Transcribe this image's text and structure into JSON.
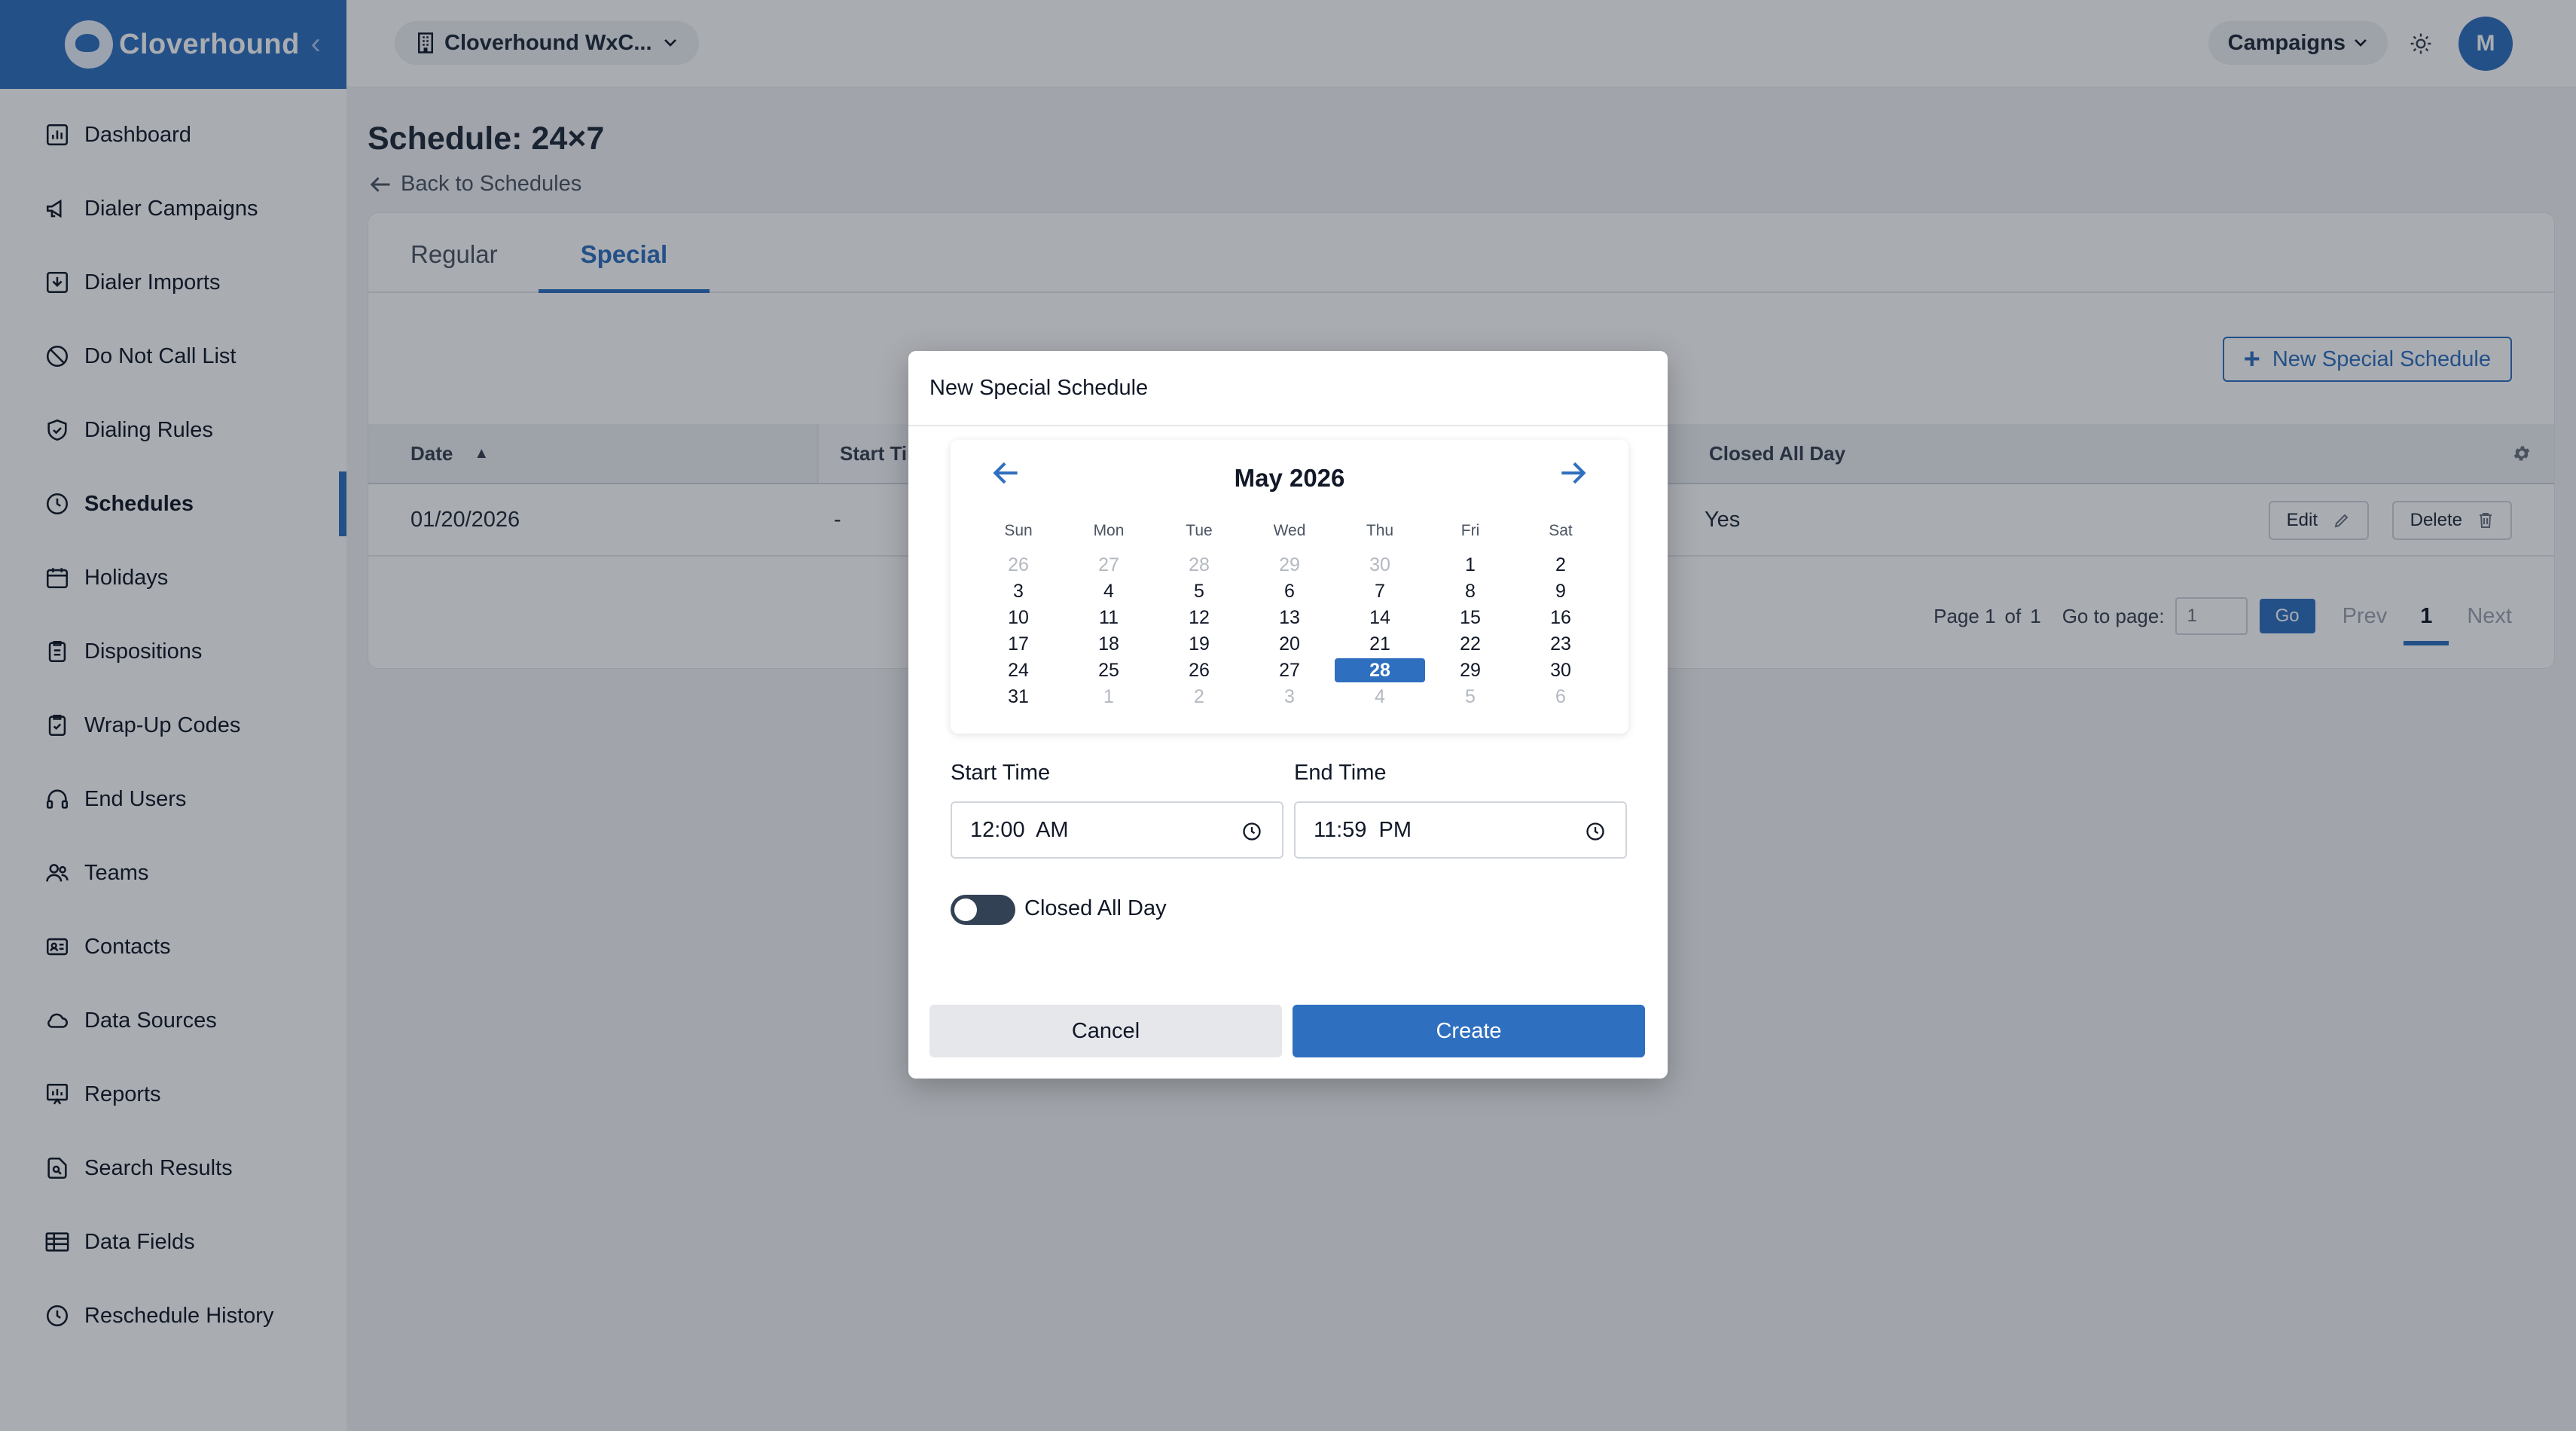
{
  "brand": {
    "name": "Cloverhound",
    "collapse_icon": "chevron-left-icon"
  },
  "sidebar": {
    "items": [
      {
        "label": "Dashboard",
        "icon": "dashboard-icon"
      },
      {
        "label": "Dialer Campaigns",
        "icon": "megaphone-icon"
      },
      {
        "label": "Dialer Imports",
        "icon": "import-icon"
      },
      {
        "label": "Do Not Call List",
        "icon": "ban-icon"
      },
      {
        "label": "Dialing Rules",
        "icon": "shield-check-icon"
      },
      {
        "label": "Schedules",
        "icon": "clock-icon",
        "active": true
      },
      {
        "label": "Holidays",
        "icon": "calendar-icon"
      },
      {
        "label": "Dispositions",
        "icon": "clipboard-icon"
      },
      {
        "label": "Wrap-Up Codes",
        "icon": "clipboard-check-icon"
      },
      {
        "label": "End Users",
        "icon": "headset-icon"
      },
      {
        "label": "Teams",
        "icon": "users-icon"
      },
      {
        "label": "Contacts",
        "icon": "contact-card-icon"
      },
      {
        "label": "Data Sources",
        "icon": "cloud-icon"
      },
      {
        "label": "Reports",
        "icon": "report-chart-icon"
      },
      {
        "label": "Search Results",
        "icon": "search-file-icon"
      },
      {
        "label": "Data Fields",
        "icon": "table-icon"
      },
      {
        "label": "Reschedule History",
        "icon": "history-icon"
      }
    ]
  },
  "topbar": {
    "org_label": "Cloverhound WxC...",
    "campaigns_label": "Campaigns",
    "avatar_initial": "M"
  },
  "page": {
    "title": "Schedule: 24×7",
    "back_label": "Back to Schedules",
    "tabs": [
      {
        "label": "Regular"
      },
      {
        "label": "Special",
        "active": true
      }
    ],
    "new_button_label": "New Special Schedule",
    "table": {
      "headers": {
        "date": "Date",
        "start": "Start Time",
        "closed": "Closed All Day"
      },
      "rows": [
        {
          "date": "01/20/2026",
          "start": "-",
          "closed": "Yes"
        }
      ],
      "edit_label": "Edit",
      "delete_label": "Delete"
    },
    "pagination": {
      "page_prefix": "Page 1",
      "of_label": "of",
      "total_pages": "1",
      "goto_label": "Go to page:",
      "goto_value": "1",
      "go_label": "Go",
      "prev_label": "Prev",
      "current": "1",
      "next_label": "Next"
    }
  },
  "modal": {
    "title": "New Special Schedule",
    "calendar": {
      "month_label": "May 2026",
      "weekdays": [
        "Sun",
        "Mon",
        "Tue",
        "Wed",
        "Thu",
        "Fri",
        "Sat"
      ],
      "weeks": [
        [
          {
            "d": "26",
            "muted": true
          },
          {
            "d": "27",
            "muted": true
          },
          {
            "d": "28",
            "muted": true
          },
          {
            "d": "29",
            "muted": true
          },
          {
            "d": "30",
            "muted": true
          },
          {
            "d": "1"
          },
          {
            "d": "2"
          }
        ],
        [
          {
            "d": "3"
          },
          {
            "d": "4"
          },
          {
            "d": "5"
          },
          {
            "d": "6"
          },
          {
            "d": "7"
          },
          {
            "d": "8"
          },
          {
            "d": "9"
          }
        ],
        [
          {
            "d": "10"
          },
          {
            "d": "11"
          },
          {
            "d": "12"
          },
          {
            "d": "13"
          },
          {
            "d": "14"
          },
          {
            "d": "15"
          },
          {
            "d": "16"
          }
        ],
        [
          {
            "d": "17"
          },
          {
            "d": "18"
          },
          {
            "d": "19"
          },
          {
            "d": "20"
          },
          {
            "d": "21"
          },
          {
            "d": "22"
          },
          {
            "d": "23"
          }
        ],
        [
          {
            "d": "24"
          },
          {
            "d": "25"
          },
          {
            "d": "26"
          },
          {
            "d": "27"
          },
          {
            "d": "28",
            "selected": true
          },
          {
            "d": "29"
          },
          {
            "d": "30"
          }
        ],
        [
          {
            "d": "31"
          },
          {
            "d": "1",
            "muted": true
          },
          {
            "d": "2",
            "muted": true
          },
          {
            "d": "3",
            "muted": true
          },
          {
            "d": "4",
            "muted": true
          },
          {
            "d": "5",
            "muted": true
          },
          {
            "d": "6",
            "muted": true
          }
        ]
      ]
    },
    "start_time_label": "Start Time",
    "start_time_value": "12:00  AM",
    "end_time_label": "End Time",
    "end_time_value": "11:59  PM",
    "closed_all_day_label": "Closed All Day",
    "closed_all_day": false,
    "cancel_label": "Cancel",
    "create_label": "Create"
  },
  "colors": {
    "accent": "#2f6fbf",
    "overlay": "rgba(17,24,39,0.36)"
  }
}
